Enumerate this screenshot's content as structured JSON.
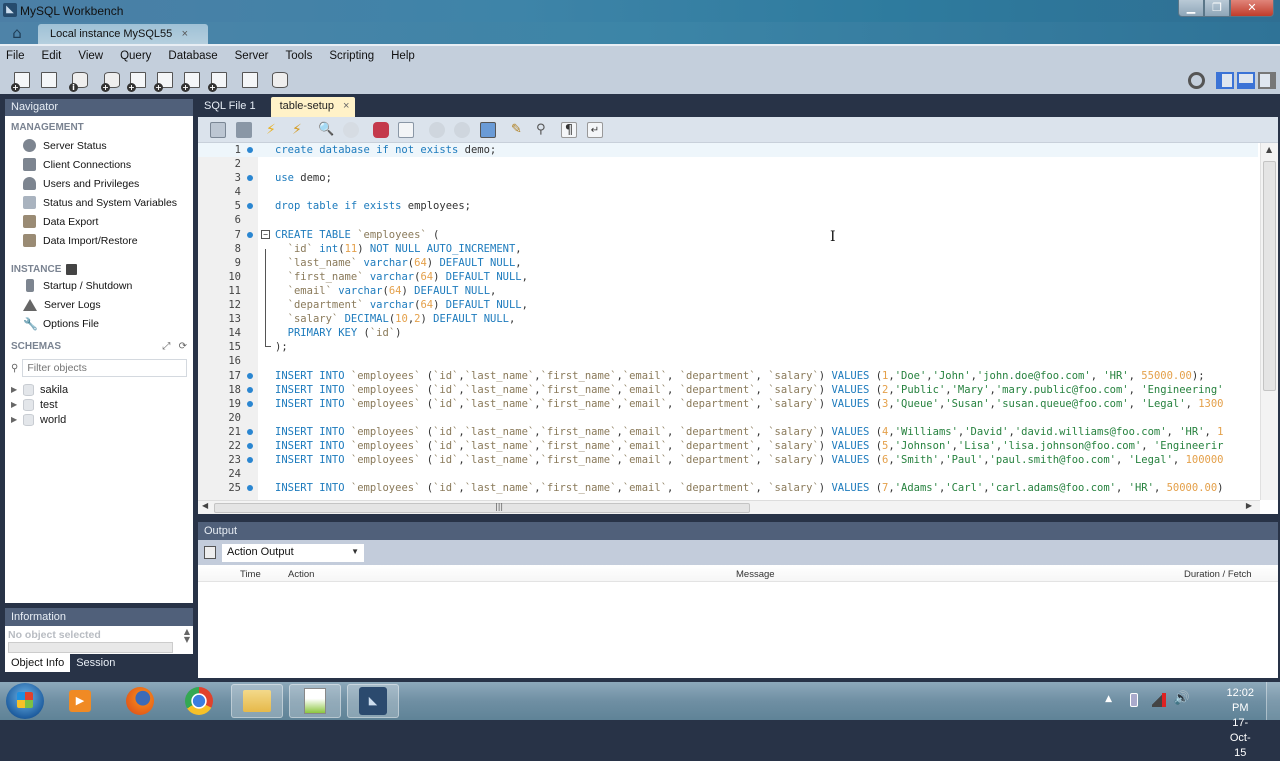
{
  "window": {
    "title": "MySQL Workbench",
    "connection_tab": "Local instance MySQL55",
    "close_glyph": "×"
  },
  "menu": [
    "File",
    "Edit",
    "View",
    "Query",
    "Database",
    "Server",
    "Tools",
    "Scripting",
    "Help"
  ],
  "toolbar_icons": [
    "new-sql-tab-icon",
    "open-sql-script-icon",
    "db-info-icon",
    "create-schema-icon",
    "create-table-icon",
    "create-view-icon",
    "create-procedure-icon",
    "create-function-icon",
    "search-table-data-icon",
    "reconnect-icon"
  ],
  "navigator": {
    "title": "Navigator",
    "management_label": "MANAGEMENT",
    "management_items": [
      {
        "label": "Server Status",
        "icon": "server-status-icon"
      },
      {
        "label": "Client Connections",
        "icon": "client-connections-icon"
      },
      {
        "label": "Users and Privileges",
        "icon": "users-icon"
      },
      {
        "label": "Status and System Variables",
        "icon": "monitor-icon"
      },
      {
        "label": "Data Export",
        "icon": "data-export-icon"
      },
      {
        "label": "Data Import/Restore",
        "icon": "data-import-icon"
      }
    ],
    "instance_label": "INSTANCE",
    "instance_items": [
      {
        "label": "Startup / Shutdown",
        "icon": "traffic-light-icon"
      },
      {
        "label": "Server Logs",
        "icon": "warning-icon"
      },
      {
        "label": "Options File",
        "icon": "wrench-icon"
      }
    ],
    "schemas_label": "SCHEMAS",
    "filter_placeholder": "Filter objects",
    "schemas": [
      "sakila",
      "test",
      "world"
    ]
  },
  "information": {
    "title": "Information",
    "empty_text": "No object selected",
    "tabs": [
      "Object Info",
      "Session"
    ]
  },
  "editor_tabs": [
    {
      "label": "SQL File 1",
      "active": false
    },
    {
      "label": "table-setup",
      "active": true
    }
  ],
  "editor": {
    "lines": [
      {
        "n": "1",
        "dot": true,
        "html": "<span class='k'>create database if not exists</span> demo;"
      },
      {
        "n": "2",
        "dot": false,
        "html": ""
      },
      {
        "n": "3",
        "dot": true,
        "html": "<span class='k'>use</span> demo;"
      },
      {
        "n": "4",
        "dot": false,
        "html": ""
      },
      {
        "n": "5",
        "dot": true,
        "html": "<span class='k'>drop table if exists</span> employees;"
      },
      {
        "n": "6",
        "dot": false,
        "html": ""
      },
      {
        "n": "7",
        "dot": true,
        "html": "<span class='k'>CREATE TABLE</span> <span class='b'>`employees`</span> ("
      },
      {
        "n": "8",
        "dot": false,
        "html": "  <span class='b'>`id`</span> <span class='k'>int</span>(<span class='n'>11</span>) <span class='k'>NOT NULL AUTO_INCREMENT</span>,"
      },
      {
        "n": "9",
        "dot": false,
        "html": "  <span class='b'>`last_name`</span> <span class='k'>varchar</span>(<span class='n'>64</span>) <span class='k'>DEFAULT NULL</span>,"
      },
      {
        "n": "10",
        "dot": false,
        "html": "  <span class='b'>`first_name`</span> <span class='k'>varchar</span>(<span class='n'>64</span>) <span class='k'>DEFAULT NULL</span>,"
      },
      {
        "n": "11",
        "dot": false,
        "html": "  <span class='b'>`email`</span> <span class='k'>varchar</span>(<span class='n'>64</span>) <span class='k'>DEFAULT NULL</span>,"
      },
      {
        "n": "12",
        "dot": false,
        "html": "  <span class='b'>`department`</span> <span class='k'>varchar</span>(<span class='n'>64</span>) <span class='k'>DEFAULT NULL</span>,"
      },
      {
        "n": "13",
        "dot": false,
        "html": "  <span class='b'>`salary`</span> <span class='k'>DECIMAL</span>(<span class='n'>10</span>,<span class='n'>2</span>) <span class='k'>DEFAULT NULL</span>,"
      },
      {
        "n": "14",
        "dot": false,
        "html": "  <span class='k'>PRIMARY KEY</span> (<span class='b'>`id`</span>)"
      },
      {
        "n": "15",
        "dot": false,
        "html": ");"
      },
      {
        "n": "16",
        "dot": false,
        "html": ""
      },
      {
        "n": "17",
        "dot": true,
        "html": "<span class='k'>INSERT INTO</span> <span class='b'>`employees`</span> (<span class='b'>`id`</span>,<span class='b'>`last_name`</span>,<span class='b'>`first_name`</span>,<span class='b'>`email`</span>, <span class='b'>`department`</span>, <span class='b'>`salary`</span>) <span class='k'>VALUES</span> (<span class='n'>1</span>,<span class='s'>'Doe'</span>,<span class='s'>'John'</span>,<span class='s'>'john.doe@foo.com'</span>, <span class='s'>'HR'</span>, <span class='n'>55000.00</span>);"
      },
      {
        "n": "18",
        "dot": true,
        "html": "<span class='k'>INSERT INTO</span> <span class='b'>`employees`</span> (<span class='b'>`id`</span>,<span class='b'>`last_name`</span>,<span class='b'>`first_name`</span>,<span class='b'>`email`</span>, <span class='b'>`department`</span>, <span class='b'>`salary`</span>) <span class='k'>VALUES</span> (<span class='n'>2</span>,<span class='s'>'Public'</span>,<span class='s'>'Mary'</span>,<span class='s'>'mary.public@foo.com'</span>, <span class='s'>'Engineering'</span>"
      },
      {
        "n": "19",
        "dot": true,
        "html": "<span class='k'>INSERT INTO</span> <span class='b'>`employees`</span> (<span class='b'>`id`</span>,<span class='b'>`last_name`</span>,<span class='b'>`first_name`</span>,<span class='b'>`email`</span>, <span class='b'>`department`</span>, <span class='b'>`salary`</span>) <span class='k'>VALUES</span> (<span class='n'>3</span>,<span class='s'>'Queue'</span>,<span class='s'>'Susan'</span>,<span class='s'>'susan.queue@foo.com'</span>, <span class='s'>'Legal'</span>, <span class='n'>1300</span>"
      },
      {
        "n": "20",
        "dot": false,
        "html": ""
      },
      {
        "n": "21",
        "dot": true,
        "html": "<span class='k'>INSERT INTO</span> <span class='b'>`employees`</span> (<span class='b'>`id`</span>,<span class='b'>`last_name`</span>,<span class='b'>`first_name`</span>,<span class='b'>`email`</span>, <span class='b'>`department`</span>, <span class='b'>`salary`</span>) <span class='k'>VALUES</span> (<span class='n'>4</span>,<span class='s'>'Williams'</span>,<span class='s'>'David'</span>,<span class='s'>'david.williams@foo.com'</span>, <span class='s'>'HR'</span>, <span class='n'>1</span>"
      },
      {
        "n": "22",
        "dot": true,
        "html": "<span class='k'>INSERT INTO</span> <span class='b'>`employees`</span> (<span class='b'>`id`</span>,<span class='b'>`last_name`</span>,<span class='b'>`first_name`</span>,<span class='b'>`email`</span>, <span class='b'>`department`</span>, <span class='b'>`salary`</span>) <span class='k'>VALUES</span> (<span class='n'>5</span>,<span class='s'>'Johnson'</span>,<span class='s'>'Lisa'</span>,<span class='s'>'lisa.johnson@foo.com'</span>, <span class='s'>'Engineerir</span>"
      },
      {
        "n": "23",
        "dot": true,
        "html": "<span class='k'>INSERT INTO</span> <span class='b'>`employees`</span> (<span class='b'>`id`</span>,<span class='b'>`last_name`</span>,<span class='b'>`first_name`</span>,<span class='b'>`email`</span>, <span class='b'>`department`</span>, <span class='b'>`salary`</span>) <span class='k'>VALUES</span> (<span class='n'>6</span>,<span class='s'>'Smith'</span>,<span class='s'>'Paul'</span>,<span class='s'>'paul.smith@foo.com'</span>, <span class='s'>'Legal'</span>, <span class='n'>100000</span>"
      },
      {
        "n": "24",
        "dot": false,
        "html": ""
      },
      {
        "n": "25",
        "dot": true,
        "html": "<span class='k'>INSERT INTO</span> <span class='b'>`employees`</span> (<span class='b'>`id`</span>,<span class='b'>`last_name`</span>,<span class='b'>`first_name`</span>,<span class='b'>`email`</span>, <span class='b'>`department`</span>, <span class='b'>`salary`</span>) <span class='k'>VALUES</span> (<span class='n'>7</span>,<span class='s'>'Adams'</span>,<span class='s'>'Carl'</span>,<span class='s'>'carl.adams@foo.com'</span>, <span class='s'>'HR'</span>, <span class='n'>50000.00</span>)"
      }
    ],
    "colors": {
      "keyword": "#1d7bbd",
      "string": "#27823f",
      "number": "#e4a04a",
      "identifier": "#8a7a5a"
    }
  },
  "output": {
    "title": "Output",
    "selector_value": "Action Output",
    "columns": [
      "Time",
      "Action",
      "Message",
      "Duration / Fetch"
    ]
  },
  "taskbar": {
    "apps": [
      "windows-media-player-icon",
      "firefox-icon",
      "chrome-icon",
      "file-explorer-icon",
      "notepad-plus-plus-icon",
      "mysql-workbench-icon"
    ],
    "time": "12:02 PM",
    "date": "17-Oct-15"
  }
}
